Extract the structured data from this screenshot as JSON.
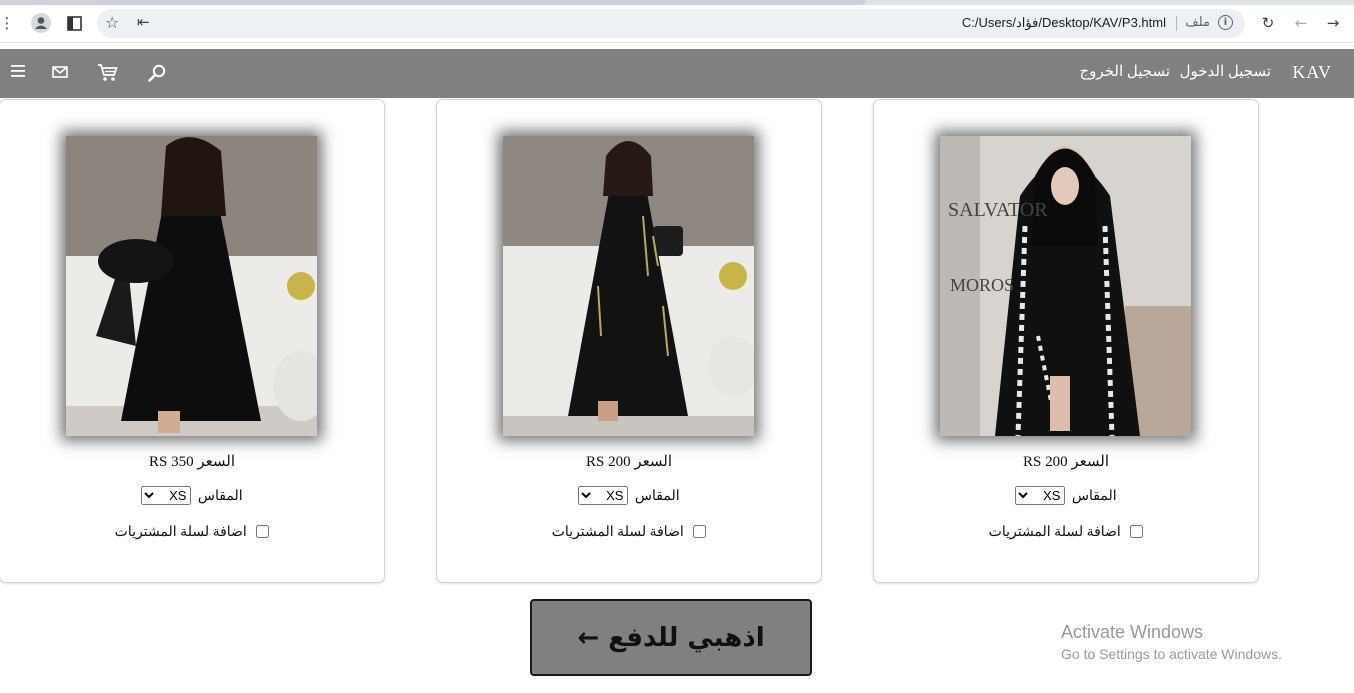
{
  "browser": {
    "url": "C:/Users/فؤاد/Desktop/KAV/P3.html",
    "file_label": "ملف"
  },
  "nav": {
    "brand": "KAV",
    "login": "تسجيل الدخول",
    "logout": "تسجيل الخروج"
  },
  "products": [
    {
      "price": "السعر RS 200",
      "size_label": "المقاس",
      "size_value": "XS",
      "cart_label": "اضافة لسلة المشتريات"
    },
    {
      "price": "السعر RS 200",
      "size_label": "المقاس",
      "size_value": "XS",
      "cart_label": "اضافة لسلة المشتريات"
    },
    {
      "price": "السعر RS 350",
      "size_label": "المقاس",
      "size_value": "XS",
      "cart_label": "اضافة لسلة المشتريات"
    }
  ],
  "checkout": {
    "label": "اذهبي للدفع ←"
  },
  "windows_watermark": {
    "title": "Activate Windows",
    "subtitle": "Go to Settings to activate Windows."
  },
  "colors": {
    "nav_bg": "#808080",
    "button_bg": "#808080",
    "text": "#111111"
  }
}
